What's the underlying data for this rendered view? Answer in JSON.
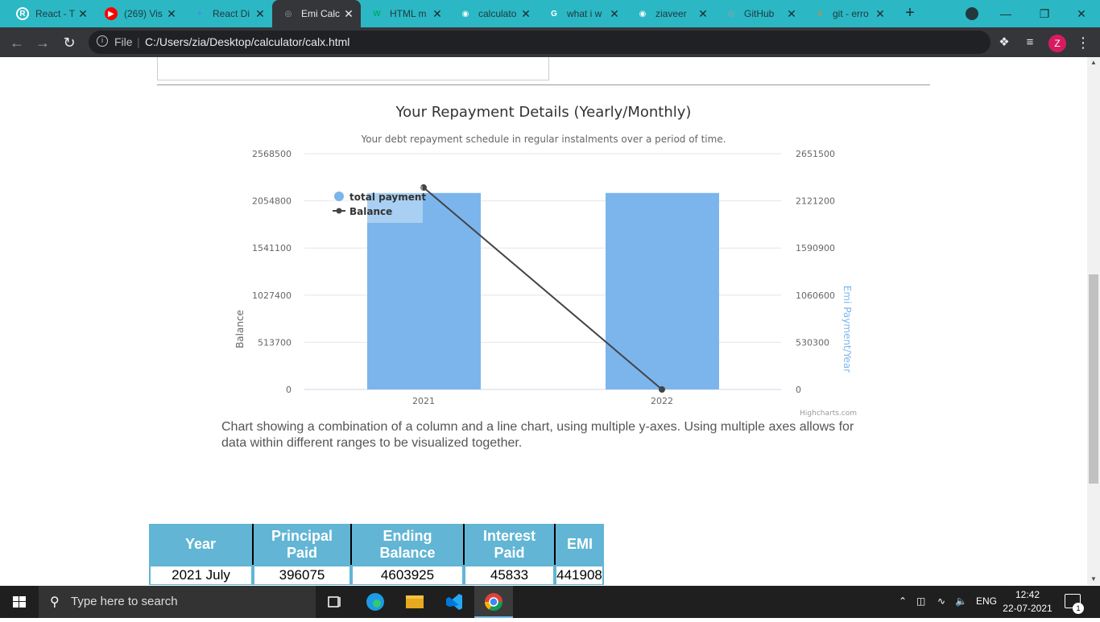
{
  "browser": {
    "tabs": [
      {
        "title": "React - T",
        "icon": "react-icon",
        "color": "#ffffff"
      },
      {
        "title": "(269) Vis",
        "icon": "youtube-icon",
        "color": "#ff0000"
      },
      {
        "title": "React Di",
        "icon": "react-dnd-icon",
        "color": "#4a90e2"
      },
      {
        "title": "Emi Calc",
        "icon": "globe-icon",
        "color": "#9aa0a6"
      },
      {
        "title": "HTML m",
        "icon": "w3schools-icon",
        "color": "#04aa6d"
      },
      {
        "title": "calculato",
        "icon": "github-icon",
        "color": "#ffffff"
      },
      {
        "title": "what i w",
        "icon": "google-icon",
        "color": "#ffffff"
      },
      {
        "title": "ziaveer",
        "icon": "github-icon",
        "color": "#ffffff"
      },
      {
        "title": "GitHub",
        "icon": "globe-icon",
        "color": "#9aa0a6"
      },
      {
        "title": "git - erro",
        "icon": "stackoverflow-icon",
        "color": "#f48024"
      }
    ],
    "address": {
      "security_label": "File",
      "url": "C:/Users/zia/Desktop/calculator/calx.html"
    },
    "profile_initial": "Z"
  },
  "chart_data": {
    "type": "bar",
    "title": "Your Repayment Details (Yearly/Monthly)",
    "subtitle": "Your debt repayment schedule in regular instalments over a period of time.",
    "categories": [
      "2021",
      "2022"
    ],
    "series": [
      {
        "name": "total payment",
        "type": "column",
        "axis": "right",
        "values": [
          2210000,
          2210000
        ],
        "color": "#7cb5ec"
      },
      {
        "name": "Balance",
        "type": "line",
        "axis": "left",
        "values": [
          2200000,
          0
        ],
        "color": "#434348"
      }
    ],
    "left_axis": {
      "label": "Balance",
      "ticks": [
        "0",
        "513700",
        "1027400",
        "1541100",
        "2054800",
        "2568500"
      ],
      "ylim": [
        0,
        2568500
      ]
    },
    "right_axis": {
      "label": "Emi Payment/Year",
      "ticks": [
        "0",
        "530300",
        "1060600",
        "1590900",
        "2121200",
        "2651500"
      ],
      "ylim": [
        0,
        2651500
      ]
    },
    "legend": "top-left",
    "credits": "Highcharts.com"
  },
  "chart_description": "Chart showing a combination of a column and a line chart, using multiple y-axes. Using multiple axes allows for data within different ranges to be visualized together.",
  "table": {
    "headers": [
      "Year",
      "Principal Paid",
      "Ending Balance",
      "Interest Paid",
      "EMI"
    ],
    "rows": [
      [
        "2021 July",
        "396075",
        "4603925",
        "45833",
        "441908"
      ]
    ]
  },
  "taskbar": {
    "search_placeholder": "Type here to search",
    "language": "ENG",
    "time": "12:42",
    "date": "22-07-2021",
    "notification_count": "1"
  }
}
